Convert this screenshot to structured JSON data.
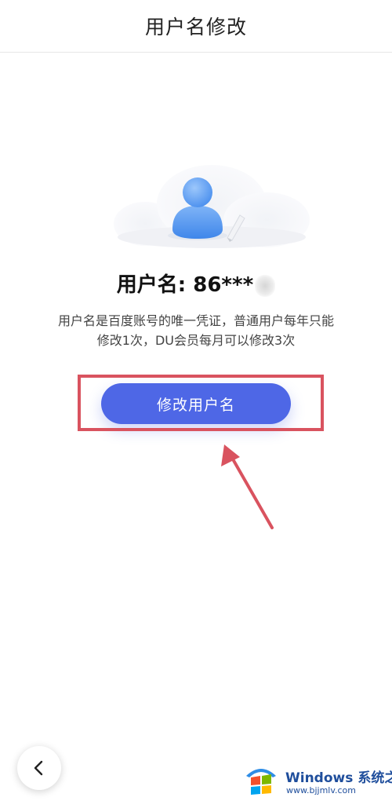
{
  "header": {
    "title": "用户名修改"
  },
  "profile": {
    "username_label": "用户名: 86***",
    "description_line1": "用户名是百度账号的唯一凭证，普通用户每年只能",
    "description_line2": "修改1次，DU会员每月可以修改3次",
    "avatar_icon": "user-avatar-icon",
    "edit_icon": "pen-icon"
  },
  "actions": {
    "change_username_label": "修改用户名",
    "back_icon": "chevron-left-icon"
  },
  "annotation": {
    "highlight_color": "#d9535f",
    "arrow_color": "#d9535f"
  },
  "watermark": {
    "brand": "Windows",
    "brand_cn": "系统之家",
    "url": "www.bjjmlv.com"
  },
  "colors": {
    "primary": "#4e67e6",
    "avatar_blue": "#5a9cf0"
  }
}
